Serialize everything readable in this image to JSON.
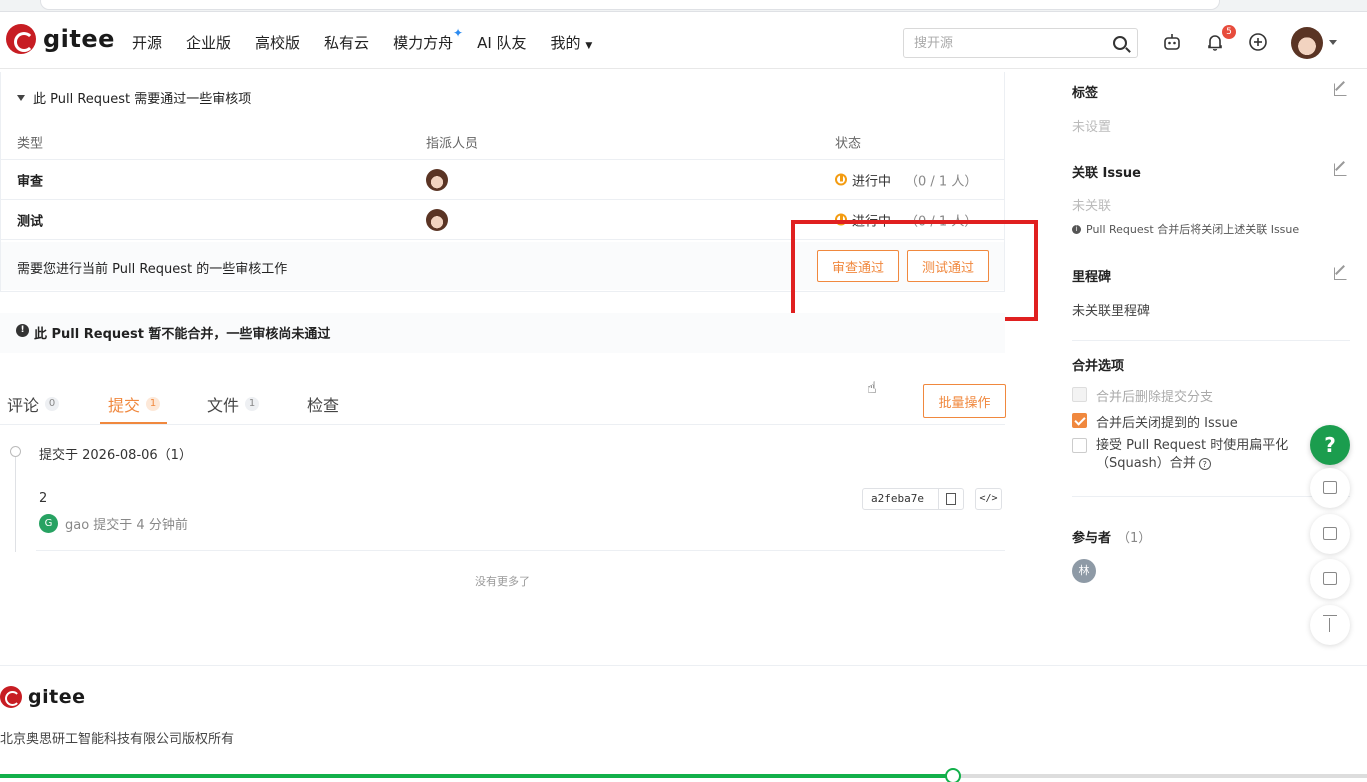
{
  "header": {
    "logo_text": "gitee",
    "nav": [
      "开源",
      "企业版",
      "高校版",
      "私有云",
      "模力方舟",
      "AI 队友",
      "我的"
    ],
    "search_placeholder": "搜开源",
    "notification_count": "5"
  },
  "review": {
    "title": "此 Pull Request 需要通过一些审核项",
    "columns": [
      "类型",
      "指派人员",
      "状态"
    ],
    "rows": [
      {
        "type": "审查",
        "status": "进行中",
        "count": "（0 / 1 人）"
      },
      {
        "type": "测试",
        "status": "进行中",
        "count": "（0 / 1 人）"
      }
    ],
    "footer_msg": "需要您进行当前 Pull Request 的一些审核工作",
    "approve_review_label": "审查通过",
    "approve_test_label": "测试通过"
  },
  "merge_warning": "此 Pull Request 暂不能合并，一些审核尚未通过",
  "tabs": [
    {
      "label": "评论",
      "count": "0"
    },
    {
      "label": "提交",
      "count": "1"
    },
    {
      "label": "文件",
      "count": "1"
    },
    {
      "label": "检查",
      "count": ""
    }
  ],
  "batch_label": "批量操作",
  "commits": {
    "date_heading": "提交于 2026-08-06（1）",
    "message": "2",
    "author_initial": "G",
    "author_text": "gao 提交于 4 分钟前",
    "sha": "a2feba7e",
    "code_glyph": "</>",
    "no_more": "没有更多了"
  },
  "sidebar": {
    "labels_title": "标签",
    "labels_value": "未设置",
    "issue_title": "关联 Issue",
    "issue_value": "未关联",
    "issue_note": "Pull Request 合并后将关闭上述关联 Issue",
    "milestone_title": "里程碑",
    "milestone_value": "未关联里程碑",
    "merge_title": "合并选项",
    "merge_options": [
      {
        "label": "合并后删除提交分支",
        "checked": false,
        "disabled": true
      },
      {
        "label": "合并后关闭提到的 Issue",
        "checked": true,
        "disabled": false
      },
      {
        "label": "接受 Pull Request 时使用扁平化（Squash）合并",
        "checked": false,
        "disabled": false
      }
    ],
    "participants_title": "参与者",
    "participants_count": "（1）",
    "participant_initial": "林"
  },
  "float": {
    "help": "?"
  },
  "footer": {
    "logo_text": "gitee",
    "copyright": "北京奥思研工智能科技有限公司版权所有"
  },
  "video": {
    "progress": 0.697
  },
  "colors": {
    "brand_red": "#c71d23",
    "accent_orange": "#f0883e",
    "success_green": "#1b9d4e",
    "highlight_red": "#e02020"
  }
}
